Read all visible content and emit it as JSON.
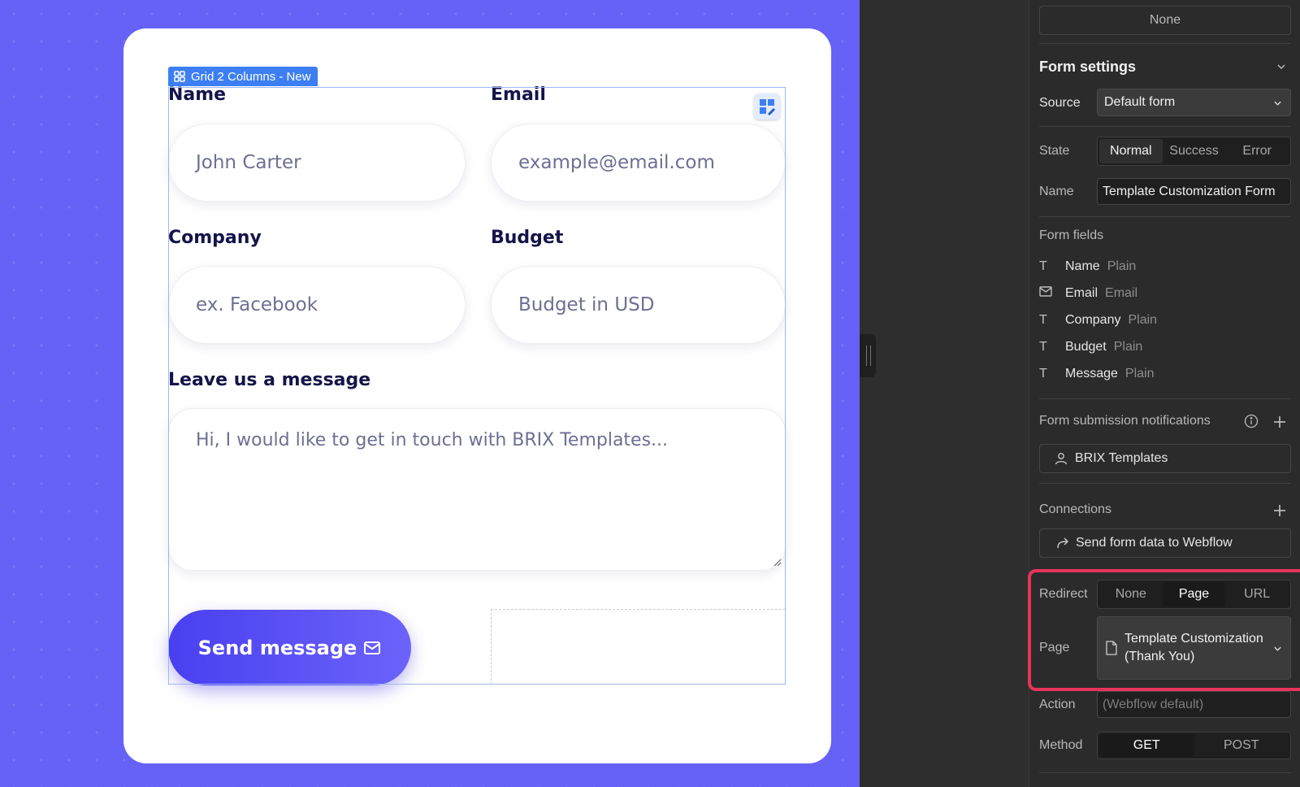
{
  "canvas": {
    "badge_label": "Grid 2 Columns - New",
    "form": {
      "name_label": "Name",
      "name_placeholder": "John Carter",
      "email_label": "Email",
      "email_placeholder": "example@email.com",
      "company_label": "Company",
      "company_placeholder": "ex. Facebook",
      "budget_label": "Budget",
      "budget_placeholder": "Budget in USD",
      "message_label": "Leave us a message",
      "message_placeholder": "Hi, I would like to get in touch with BRIX Templates...",
      "submit_label": "Send message"
    }
  },
  "panel": {
    "top_value": "None",
    "form_settings_title": "Form settings",
    "source_label": "Source",
    "source_value": "Default form",
    "state_label": "State",
    "state_options": [
      "Normal",
      "Success",
      "Error"
    ],
    "state_selected": "Normal",
    "name_label": "Name",
    "name_value": "Template Customization Form",
    "form_fields_title": "Form fields",
    "form_fields": [
      {
        "icon": "text-icon",
        "name": "Name",
        "type": "Plain"
      },
      {
        "icon": "email-icon",
        "name": "Email",
        "type": "Email"
      },
      {
        "icon": "text-icon",
        "name": "Company",
        "type": "Plain"
      },
      {
        "icon": "text-icon",
        "name": "Budget",
        "type": "Plain"
      },
      {
        "icon": "text-icon",
        "name": "Message",
        "type": "Plain"
      }
    ],
    "notifications_title": "Form submission notifications",
    "notification_recipient": "BRIX Templates",
    "connections_title": "Connections",
    "connection_item": "Send form data to Webflow",
    "redirect_label": "Redirect",
    "redirect_options": [
      "None",
      "Page",
      "URL"
    ],
    "redirect_selected": "Page",
    "page_label": "Page",
    "page_value": "Template Customization (Thank You)",
    "action_label": "Action",
    "action_placeholder": "(Webflow default)",
    "method_label": "Method",
    "method_options": [
      "GET",
      "POST"
    ],
    "method_selected": "GET",
    "highlight_color": "#e8345a",
    "accent_color": "#3d7ff2"
  }
}
